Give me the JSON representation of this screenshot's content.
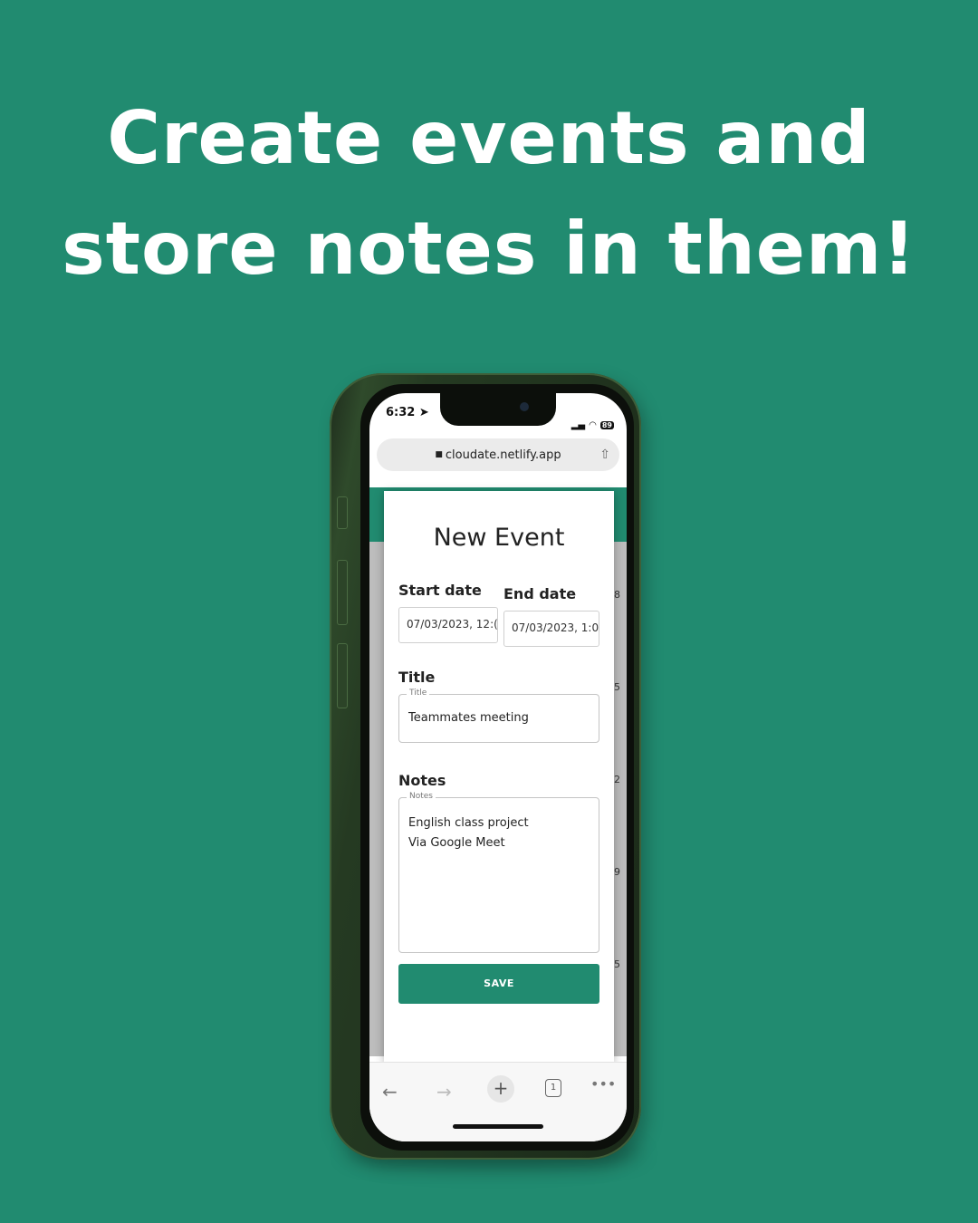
{
  "headline": {
    "line1": "Create events and",
    "line2": "store notes in them!"
  },
  "phone": {
    "status_bar": {
      "time": "6:32",
      "location_icon": "location-arrow-icon",
      "signal_icon": "signal-icon",
      "wifi_icon": "wifi-icon",
      "battery": "89"
    },
    "browser": {
      "url": "cloudate.netlify.app",
      "lock_icon": "lock-icon",
      "share_icon": "share-icon"
    },
    "dialog": {
      "title": "New Event",
      "start_date_label": "Start date",
      "start_date_value": "07/03/2023, 12:(",
      "end_date_label": "End date",
      "end_date_value": "07/03/2023, 1:0(",
      "title_label": "Title",
      "title_field_legend": "Title",
      "title_field_value": "Teammates meeting",
      "notes_label": "Notes",
      "notes_field_legend": "Notes",
      "notes_field_value": "English class project\nVia Google Meet",
      "save_label": "SAVE"
    },
    "background_calendar_numbers": [
      "8",
      "5",
      "2",
      "9",
      "5"
    ],
    "toolbar": {
      "back_icon": "back-arrow-icon",
      "forward_icon": "forward-arrow-icon",
      "new_tab_icon": "plus-icon",
      "tab_count": "1",
      "more_icon": "more-icon"
    },
    "colors": {
      "brand_green": "#218b70",
      "background": "#218b70"
    }
  }
}
